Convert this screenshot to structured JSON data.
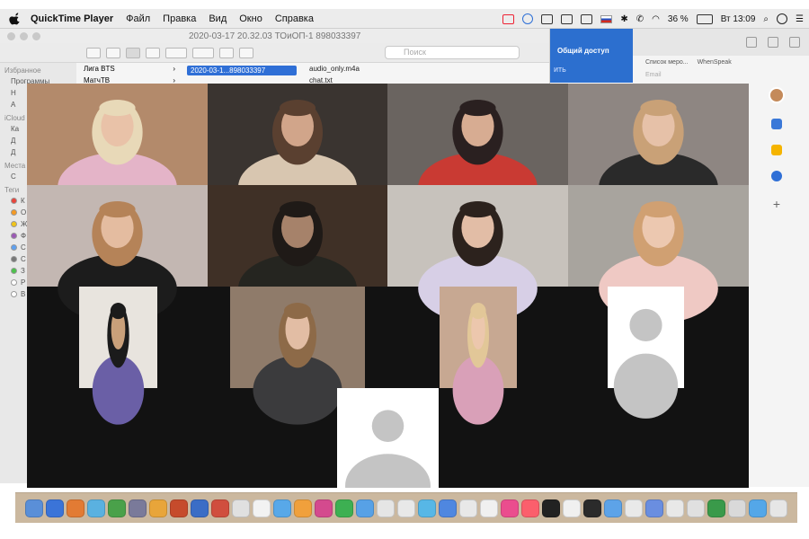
{
  "menubar": {
    "app_name": "QuickTime Player",
    "items": [
      "Файл",
      "Правка",
      "Вид",
      "Окно",
      "Справка"
    ],
    "battery": "36 %",
    "clock": "Вт 13:09"
  },
  "finder": {
    "title": "2020-03-17 20.32.03 ТОиОП-1 898033397",
    "search_placeholder": "Поиск",
    "sidebar": [
      {
        "type": "header",
        "label": "Избранное"
      },
      {
        "type": "item",
        "label": "Программы"
      },
      {
        "type": "item",
        "label": "Н"
      },
      {
        "type": "item",
        "label": "А"
      },
      {
        "type": "header",
        "label": "iCloud"
      },
      {
        "type": "item",
        "label": "Ка"
      },
      {
        "type": "item",
        "label": "Д"
      },
      {
        "type": "item",
        "label": "Д"
      },
      {
        "type": "header",
        "label": "Места"
      },
      {
        "type": "item",
        "label": "С"
      },
      {
        "type": "header",
        "label": "Теги"
      }
    ],
    "tags": [
      {
        "color": "#e8453c",
        "label": "К"
      },
      {
        "color": "#f59a23",
        "label": "О"
      },
      {
        "color": "#f0c419",
        "label": "Ж"
      },
      {
        "color": "#9b59b6",
        "label": "Ф"
      },
      {
        "color": "#5ea0ef",
        "label": "С"
      },
      {
        "color": "#777777",
        "label": "С"
      },
      {
        "color": "#4cc14c",
        "label": "З"
      },
      {
        "color": "#ffffff",
        "label": "Р"
      },
      {
        "color": "#ffffff",
        "label": "В"
      }
    ],
    "column1": [
      "Лига BTS",
      "МатчТВ"
    ],
    "column2_selected": "2020-03-1...898033397",
    "column3": [
      "audio_only.m4a",
      "chat.txt"
    ]
  },
  "share_popup": {
    "label": "Общий доступ",
    "sub": "ить"
  },
  "browser": {
    "bookmarks": [
      "Список меро...",
      "WhenSpeak",
      "Email"
    ]
  },
  "zoom": {
    "participants": [
      {
        "id": "p1",
        "bg": "#b38a6b",
        "shirt": "#e4b4c8",
        "skin": "#e9c2a8",
        "hair": "#e8d9b8"
      },
      {
        "id": "p2",
        "bg": "#3a3430",
        "shirt": "#d8c6b0",
        "skin": "#d1a58a",
        "hair": "#5a4030"
      },
      {
        "id": "p3",
        "bg": "#6a6460",
        "shirt": "#c93a33",
        "skin": "#d7ac92",
        "hair": "#2a2020"
      },
      {
        "id": "p4",
        "bg": "#8e8682",
        "shirt": "#2a2a2a",
        "skin": "#e6c1a8",
        "hair": "#c9a177"
      },
      {
        "id": "p5",
        "bg": "#c3b7b2",
        "shirt": "#1c1c1c",
        "skin": "#e4bca0",
        "hair": "#b58358"
      },
      {
        "id": "p6",
        "bg": "#3f3026",
        "shirt": "#252520",
        "skin": "#a6826a",
        "hair": "#1f1a17"
      },
      {
        "id": "p7",
        "bg": "#c7c2bc",
        "shirt": "#d7cfe6",
        "skin": "#e2bda6",
        "hair": "#2c221d"
      },
      {
        "id": "p8",
        "bg": "#a8a49e",
        "shirt": "#efc9c4",
        "skin": "#ecc8b0",
        "hair": "#d0a072"
      },
      {
        "id": "p9",
        "bg": "#e8e4de",
        "shirt": "#6a5fa6",
        "skin": "#c9a07a",
        "hair": "#1b1b1b"
      },
      {
        "id": "p10",
        "bg": "#8f7b6a",
        "shirt": "#3b3b3d",
        "skin": "#e2bda4",
        "hair": "#8d6a48"
      },
      {
        "id": "p11",
        "bg": "#c7a892",
        "shirt": "#d9a0b8",
        "skin": "#ecc7ad",
        "hair": "#e2c798"
      },
      {
        "id": "p12",
        "bg": "#ffffff",
        "avatar": true
      },
      {
        "id": "p13",
        "bg": "#ffffff",
        "avatar": true
      }
    ]
  },
  "dock": {
    "icons": [
      "#5a8fd8",
      "#3b74d8",
      "#e27b34",
      "#5ab1e0",
      "#4aa14a",
      "#7a7a9a",
      "#e8a53a",
      "#c64b2c",
      "#3b6dc6",
      "#d04e3e",
      "#e0e0e0",
      "#f2f2f2",
      "#58a8e8",
      "#f0a03c",
      "#d44a8e",
      "#3db052",
      "#57a1e6",
      "#e5e5e5",
      "#e8e8e8",
      "#57b7e6",
      "#4f87e0",
      "#e8e8e8",
      "#f0f0f0",
      "#ea4d8e",
      "#fb5f6c",
      "#222222",
      "#f0f0f0",
      "#2b2b2b",
      "#5da3e8",
      "#e9e9e9",
      "#6a8ee0",
      "#e8e8e8",
      "#e0e0e0",
      "#3a9a4a",
      "#d9d9d9",
      "#54a7e8",
      "#e6e6e6"
    ]
  }
}
